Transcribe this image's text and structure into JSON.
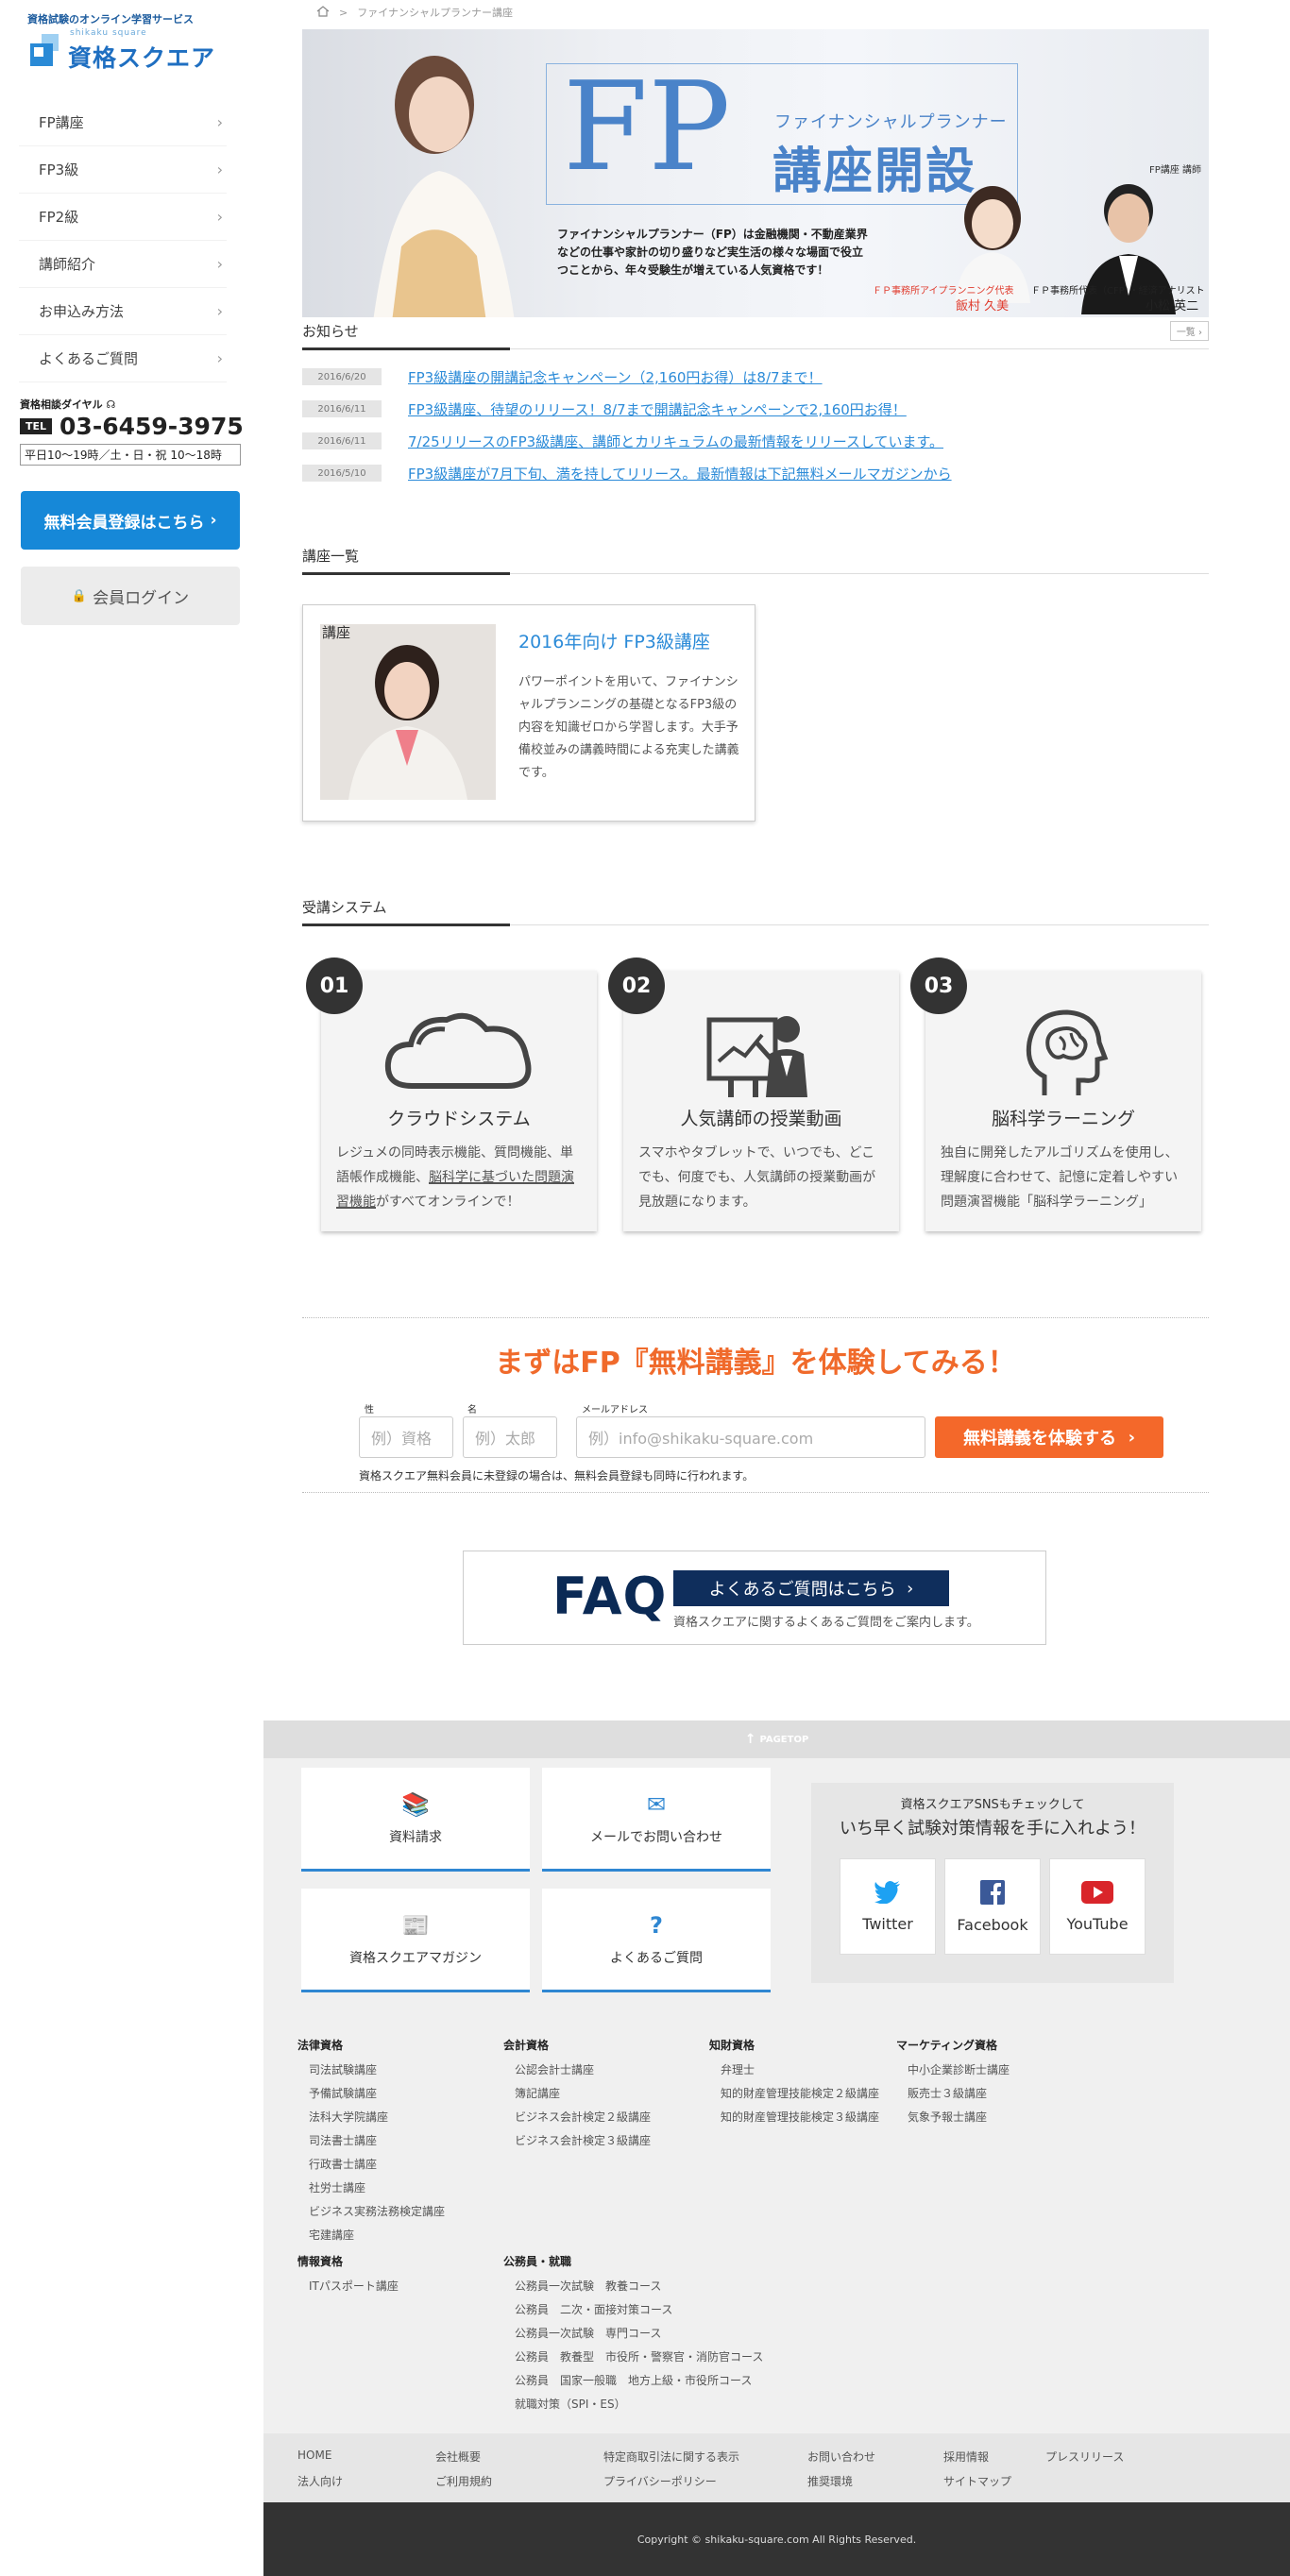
{
  "brand": {
    "tagline": "資格試験のオンライン学習サービス",
    "roman": "shikaku square",
    "name": "資格スクエア"
  },
  "sidebar": {
    "items": [
      {
        "label": "FP講座"
      },
      {
        "label": "FP3級"
      },
      {
        "label": "FP2級"
      },
      {
        "label": "講師紹介"
      },
      {
        "label": "お申込み方法"
      },
      {
        "label": "よくあるご質問"
      }
    ],
    "tel_label": "資格相談ダイヤル",
    "tel_badge": "TEL",
    "tel_number": "03-6459-3975",
    "tel_hours": "平日10〜19時／土・日・祝 10〜18時",
    "register_label": "無料会員登録はこちら",
    "login_label": "会員ログイン"
  },
  "breadcrumb": {
    "separator": ">",
    "current": "ファイナンシャルプランナー講座"
  },
  "hero": {
    "big": "FP",
    "subtitle": "ファイナンシャルプランナー",
    "title": "講座開設",
    "description": "ファイナンシャルプランナー（FP）は金融機関・不動産業界などの仕事や家計の切り盛りなど実生活の様々な場面で役立つことから、年々受験生が増えている人気資格です！",
    "lecturer_label": "FP講座 講師",
    "person1_title": "ＦＰ事務所アイプランニング代表",
    "person1_name": "飯村 久美",
    "person2_title": "ＦＰ事務所代表（CFP）・経済アナリスト",
    "person2_name": "小松 英二"
  },
  "news": {
    "heading": "お知らせ",
    "more_label": "一覧",
    "items": [
      {
        "date": "2016/6/20",
        "text": "FP3級講座の開講記念キャンペーン（2,160円お得）は8/7まで！"
      },
      {
        "date": "2016/6/11",
        "text": "FP3級講座、待望のリリース！8/7まで開講記念キャンペーンで2,160円お得！"
      },
      {
        "date": "2016/6/11",
        "text": "7/25リリースのFP3級講座、講師とカリキュラムの最新情報をリリースしています。"
      },
      {
        "date": "2016/5/10",
        "text": "FP3級講座が7月下旬、満を持してリリース。最新情報は下記無料メールマガジンから"
      }
    ]
  },
  "courses": {
    "heading": "講座一覧",
    "tag": "講座",
    "title": "2016年向け FP3級講座",
    "description": "パワーポイントを用いて、ファイナンシャルプランニングの基礎となるFP3級の内容を知識ゼロから学習します。大手予備校並みの講義時間による充実した講義です。"
  },
  "system": {
    "heading": "受講システム",
    "items": [
      {
        "num": "01",
        "title": "クラウドシステム",
        "desc_a": "レジュメの同時表示機能、質問機能、単語帳作成機能、",
        "desc_b": "脳科学に基づいた問題演習機能",
        "desc_c": "がすべてオンラインで！"
      },
      {
        "num": "02",
        "title": "人気講師の授業動画",
        "desc_a": "スマホやタブレットで、いつでも、どこでも、何度でも、人気講師の授業動画が見放題になります。"
      },
      {
        "num": "03",
        "title": "脳科学ラーニング",
        "desc_a": "独自に開発したアルゴリズムを使用し、理解度に合わせて、記憶に定着しやすい問題演習機能「脳科学ラーニング」"
      }
    ]
  },
  "trial": {
    "title": "まずはFP『無料講義』を体験してみる！",
    "last_label": "性",
    "last_placeholder": "例）資格",
    "first_label": "名",
    "first_placeholder": "例）太郎",
    "email_label": "メールアドレス",
    "email_placeholder": "例）info@shikaku-square.com",
    "button": "無料講義を体験する",
    "note": "資格スクエア無料会員に未登録の場合は、無料会員登録も同時に行われます。"
  },
  "faq": {
    "big": "FAQ",
    "button": "よくあるご質問はこちら",
    "desc": "資格スクエアに関するよくあるご質問をご案内します。"
  },
  "footer": {
    "pagetop": "PAGETOP",
    "boxes": [
      {
        "label": "資料請求",
        "icon": "books-icon"
      },
      {
        "label": "メールでお問い合わせ",
        "icon": "mail-icon"
      },
      {
        "label": "資格スクエアマガジン",
        "icon": "magazine-icon"
      },
      {
        "label": "よくあるご質問",
        "icon": "question-icon"
      }
    ],
    "sns_line1": "資格スクエアSNSもチェックして",
    "sns_line2": "いち早く試験対策情報を手に入れよう！",
    "sns": [
      {
        "label": "Twitter",
        "color": "#1da1f2"
      },
      {
        "label": "Facebook",
        "color": "#3b5998"
      },
      {
        "label": "YouTube",
        "color": "#d9252a"
      }
    ],
    "categories": [
      {
        "title": "法律資格",
        "items": [
          "司法試験講座",
          "予備試験講座",
          "法科大学院講座",
          "司法書士講座",
          "行政書士講座",
          "社労士講座",
          "ビジネス実務法務検定講座",
          "宅建講座"
        ]
      },
      {
        "title": "会計資格",
        "items": [
          "公認会計士講座",
          "簿記講座",
          "ビジネス会計検定２級講座",
          "ビジネス会計検定３級講座"
        ]
      },
      {
        "title": "知財資格",
        "items": [
          "弁理士",
          "知的財産管理技能検定２級講座",
          "知的財産管理技能検定３級講座"
        ]
      },
      {
        "title": "マーケティング資格",
        "items": [
          "中小企業診断士講座",
          "販売士３級講座",
          "気象予報士講座"
        ]
      },
      {
        "title": "情報資格",
        "items": [
          "ITパスポート講座"
        ]
      },
      {
        "title": "公務員・就職",
        "items": [
          "公務員一次試験　教養コース",
          "公務員　二次・面接対策コース",
          "公務員一次試験　専門コース",
          "公務員　教養型　市役所・警察官・消防官コース",
          "公務員　国家一般職　地方上級・市役所コース",
          "就職対策（SPI・ES）"
        ]
      }
    ],
    "bottom_links": [
      "HOME",
      "会社概要",
      "特定商取引法に関する表示",
      "お問い合わせ",
      "採用情報",
      "プレスリリース",
      "法人向け",
      "ご利用規約",
      "プライバシーポリシー",
      "推奨環境",
      "サイトマップ"
    ],
    "copyright": "Copyright © shikaku-square.com All Rights Reserved."
  }
}
